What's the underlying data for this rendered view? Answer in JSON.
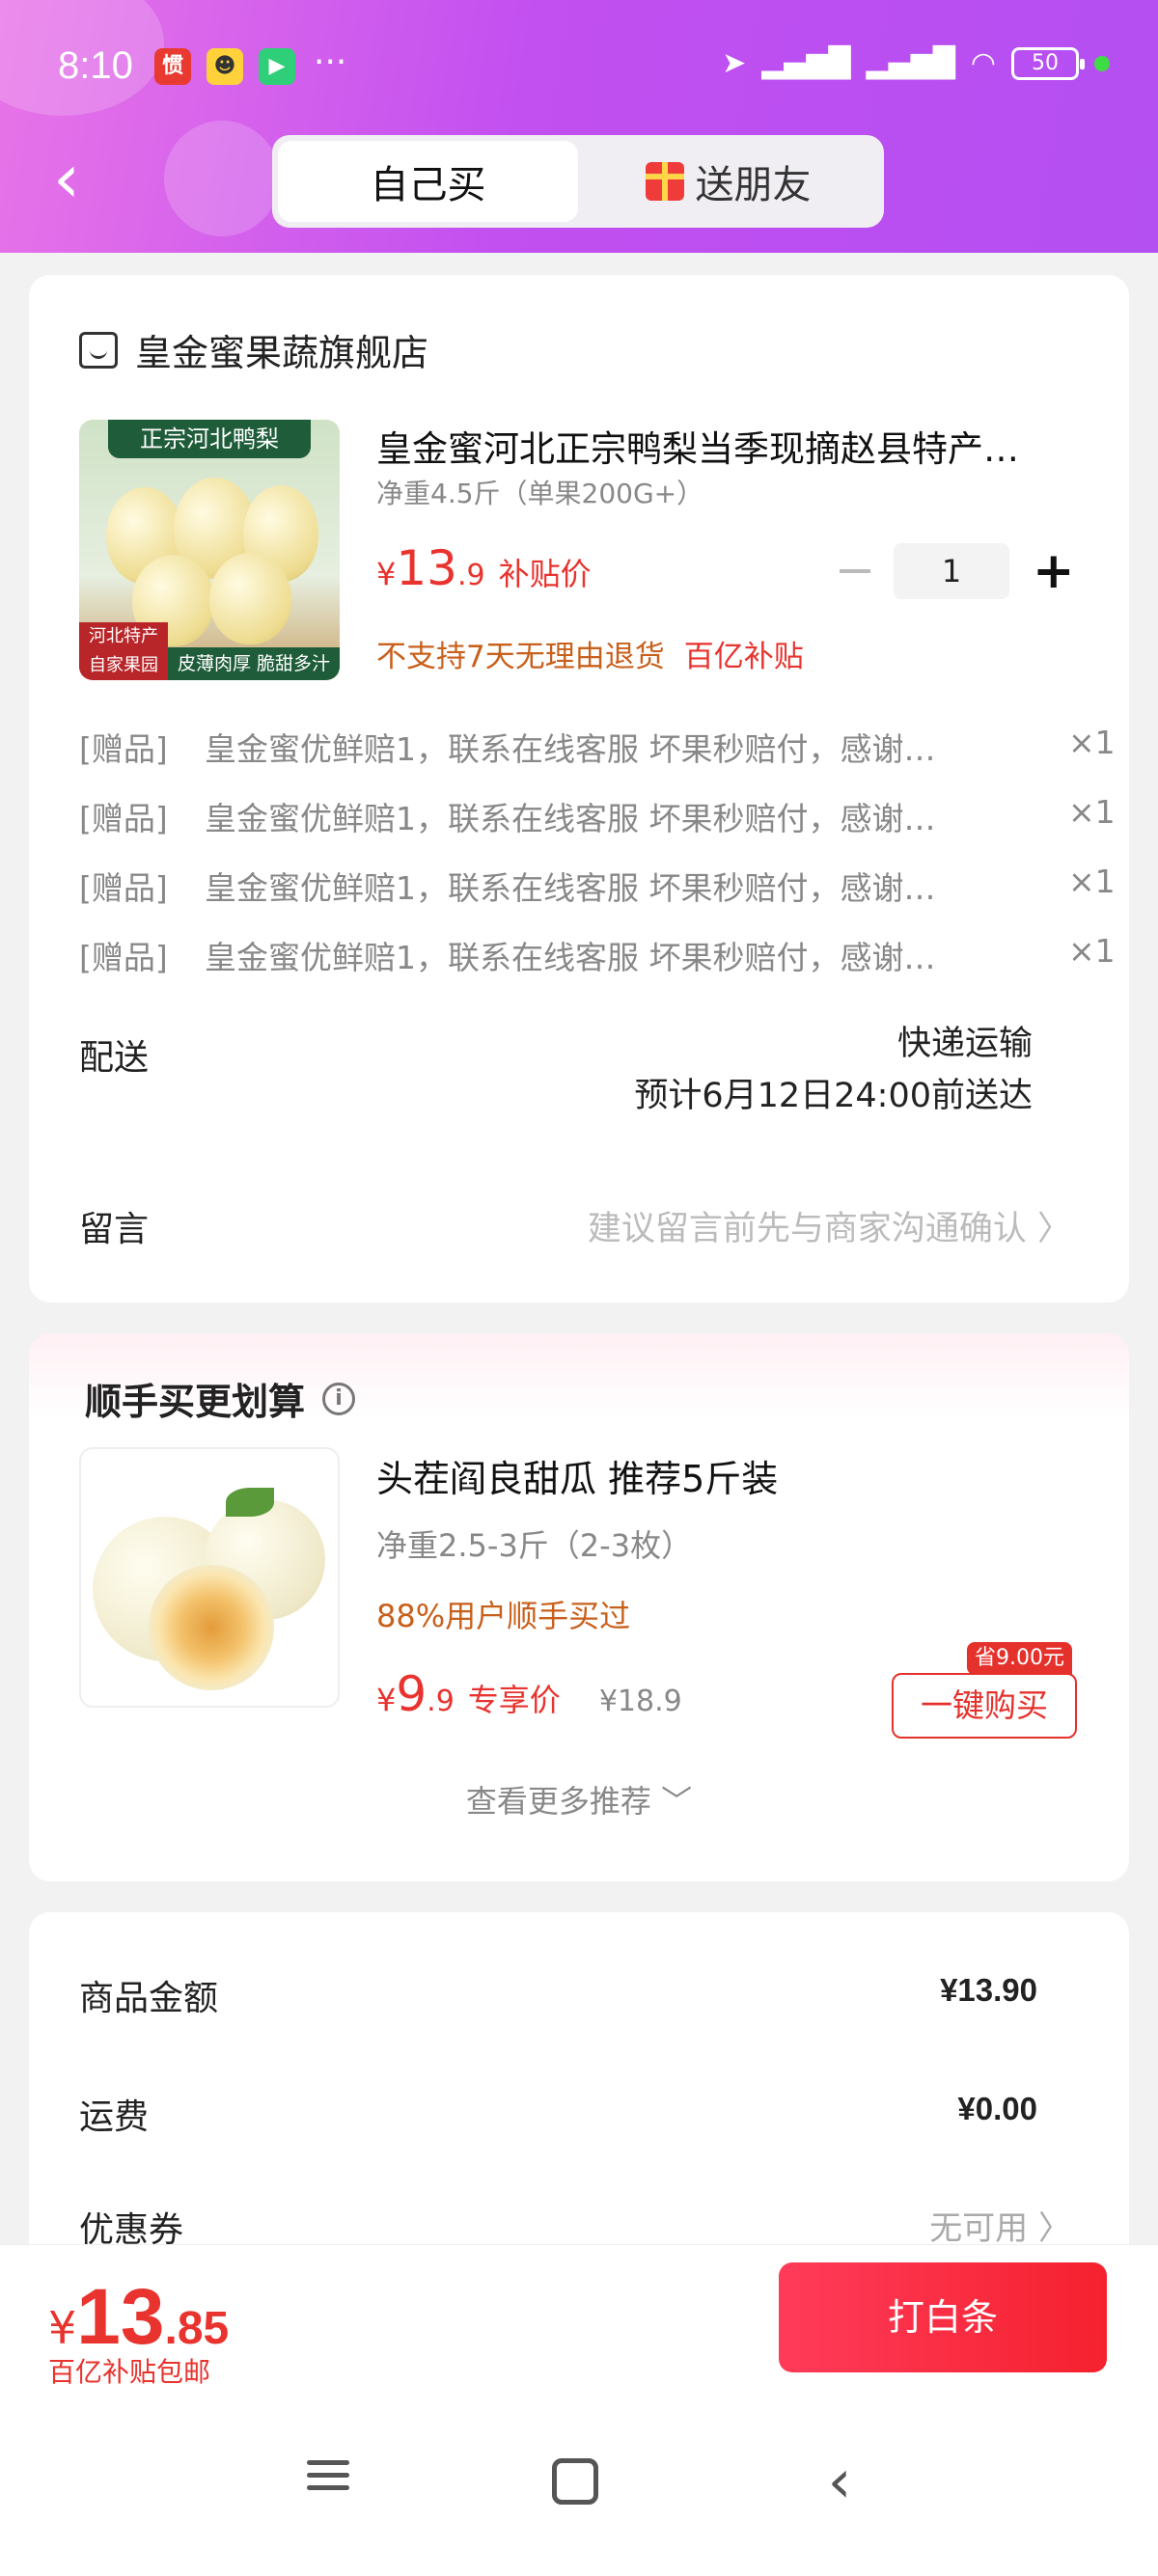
{
  "status_bar": {
    "time": "8:10",
    "dots": "···",
    "battery": "50"
  },
  "tabs": [
    {
      "label": "自己买"
    },
    {
      "label": "送朋友"
    }
  ],
  "store": {
    "name": "皇金蜜果蔬旗舰店"
  },
  "product": {
    "image_banner": "正宗河北鸭梨",
    "image_tag_left": "河北特产 自家果园",
    "image_tag_right": "皮薄肉厚 脆甜多汁",
    "title": "皇金蜜河北正宗鸭梨当季现摘赵县特产…",
    "spec": "净重4.5斤（单果200G+）",
    "price_yen": "¥",
    "price_int": "13",
    "price_dec": ".9",
    "price_label": "补贴价",
    "quantity": "1",
    "note_no_return": "不支持7天无理由退货",
    "note_subsidy": "百亿补贴"
  },
  "gifts": [
    {
      "tag": "[赠品]",
      "text": "皇金蜜优鲜赔1，联系在线客服 坏果秒赔付，感谢…",
      "qty": "×1"
    },
    {
      "tag": "[赠品]",
      "text": "皇金蜜优鲜赔1，联系在线客服 坏果秒赔付，感谢…",
      "qty": "×1"
    },
    {
      "tag": "[赠品]",
      "text": "皇金蜜优鲜赔1，联系在线客服 坏果秒赔付，感谢…",
      "qty": "×1"
    },
    {
      "tag": "[赠品]",
      "text": "皇金蜜优鲜赔1，联系在线客服 坏果秒赔付，感谢…",
      "qty": "×1"
    }
  ],
  "delivery": {
    "label": "配送",
    "method": "快递运输",
    "eta": "预计6月12日24:00前送达"
  },
  "message": {
    "label": "留言",
    "placeholder": "建议留言前先与商家沟通确认 〉"
  },
  "recommend": {
    "title": "顺手买更划算",
    "name": "头茬阎良甜瓜 推荐5斤装",
    "spec": "净重2.5-3斤（2-3枚）",
    "note": "88%用户顺手买过",
    "price_yen": "¥",
    "price_int": "9",
    "price_dec": ".9",
    "price_label": "专享价",
    "original_price": "¥18.9",
    "save_badge": "省9.00元",
    "buy_label": "一键购买",
    "more_label": "查看更多推荐 ﹀"
  },
  "summary": {
    "goods_label": "商品金额",
    "goods_value": "¥13.90",
    "shipping_label": "运费",
    "shipping_value": "¥0.00",
    "coupon_label": "优惠券",
    "coupon_value": "无可用 〉"
  },
  "footer": {
    "total_yen": "¥",
    "total_int": "13",
    "total_dec": ".85",
    "total_sub": "百亿补贴包邮",
    "pay_label": "打白条"
  },
  "colors": {
    "accent": "#e8332e",
    "header_start": "#e874e8",
    "header_end": "#b44ff2",
    "note_orange": "#c8601c"
  }
}
